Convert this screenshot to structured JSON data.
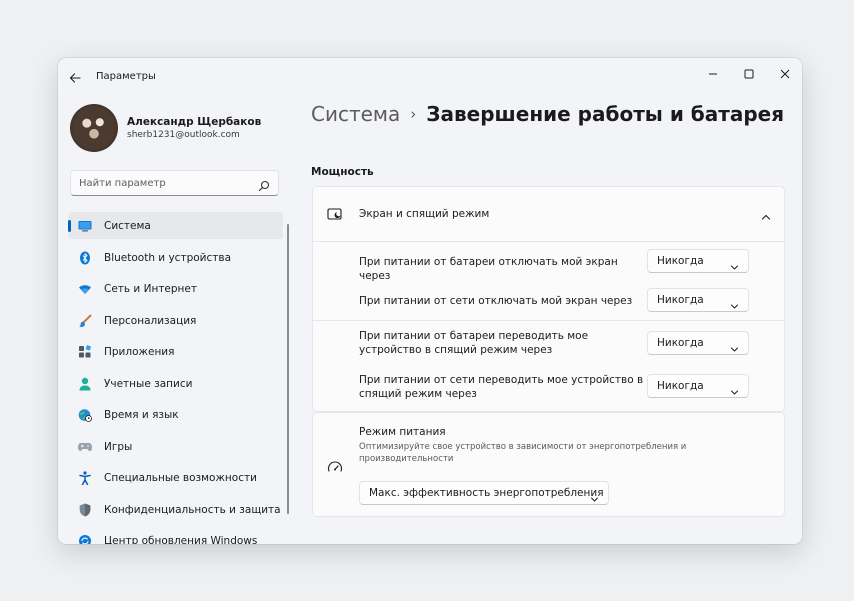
{
  "window": {
    "title": "Параметры"
  },
  "profile": {
    "name": "Александр Щербаков",
    "email": "sherb1231@outlook.com"
  },
  "search": {
    "placeholder": "Найти параметр"
  },
  "sidebar": {
    "items": [
      {
        "label": "Система",
        "icon": "monitor-icon",
        "active": true
      },
      {
        "label": "Bluetooth и устройства",
        "icon": "bluetooth-icon"
      },
      {
        "label": "Сеть и Интернет",
        "icon": "wifi-icon"
      },
      {
        "label": "Персонализация",
        "icon": "brush-icon"
      },
      {
        "label": "Приложения",
        "icon": "apps-icon"
      },
      {
        "label": "Учетные записи",
        "icon": "person-icon"
      },
      {
        "label": "Время и язык",
        "icon": "globe-clock-icon"
      },
      {
        "label": "Игры",
        "icon": "gamepad-icon"
      },
      {
        "label": "Специальные возможности",
        "icon": "accessibility-icon"
      },
      {
        "label": "Конфиденциальность и защита",
        "icon": "shield-icon"
      },
      {
        "label": "Центр обновления Windows",
        "icon": "update-icon"
      }
    ]
  },
  "breadcrumb": {
    "parent": "Система",
    "separator": "›",
    "current": "Завершение работы и батарея"
  },
  "main": {
    "section_title": "Мощность",
    "screen_sleep": {
      "title": "Экран и спящий режим",
      "settings": [
        {
          "label": "При питании от батареи отключать мой экран через",
          "value": "Никогда"
        },
        {
          "label": "При питании от сети отключать мой экран через",
          "value": "Никогда"
        },
        {
          "label": "При питании от батареи переводить мое устройство в спящий режим через",
          "value": "Никогда"
        },
        {
          "label": "При питании от сети переводить мое устройство в спящий режим через",
          "value": "Никогда"
        }
      ]
    },
    "power_mode": {
      "title": "Режим питания",
      "description": "Оптимизируйте свое устройство в зависимости от энергопотребления и производительности",
      "value": "Макс. эффективность энергопотребления"
    }
  },
  "colors": {
    "accent": "#0067c0",
    "background": "#f3f4f7",
    "card": "#fbfbfc"
  }
}
